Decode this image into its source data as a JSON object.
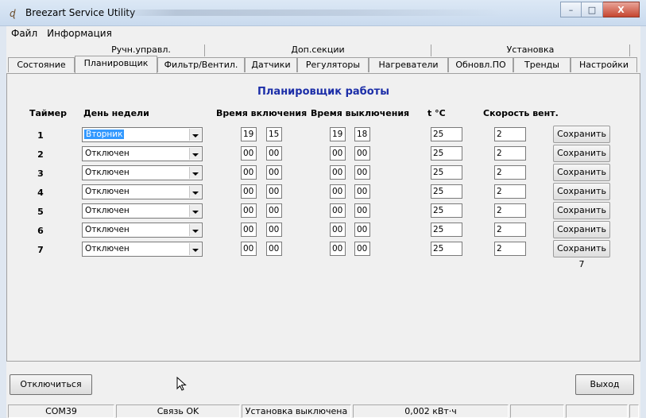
{
  "window": {
    "title": "Breezart Service Utility",
    "app_icon": "breezart-icon",
    "controls": {
      "minimize": "–",
      "maximize": "□",
      "close": "X"
    }
  },
  "menu": [
    "Файл",
    "Информация"
  ],
  "tabs": {
    "top_row": [
      "Ручн.управл.",
      "Доп.секции",
      "Установка"
    ],
    "bottom_row": [
      "Состояние",
      "Планировщик",
      "Фильтр/Вентил.",
      "Датчики",
      "Регуляторы",
      "Нагреватели",
      "Обновл.ПО",
      "Тренды",
      "Настройки"
    ],
    "active": "Планировщик"
  },
  "scheduler": {
    "title": "Планировщик работы",
    "headers": {
      "timer": "Таймер",
      "weekday": "День недели",
      "on_time": "Время включения",
      "off_time": "Время выключения",
      "temp": "t °C",
      "fan_speed": "Скорость вент."
    },
    "rows": [
      {
        "num": "1",
        "weekday": "Вторник",
        "on_h": "19",
        "on_m": "15",
        "off_h": "19",
        "off_m": "18",
        "temp": "25",
        "speed": "2",
        "save": "Сохранить 1"
      },
      {
        "num": "2",
        "weekday": "Отключен",
        "on_h": "00",
        "on_m": "00",
        "off_h": "00",
        "off_m": "00",
        "temp": "25",
        "speed": "2",
        "save": "Сохранить 2"
      },
      {
        "num": "3",
        "weekday": "Отключен",
        "on_h": "00",
        "on_m": "00",
        "off_h": "00",
        "off_m": "00",
        "temp": "25",
        "speed": "2",
        "save": "Сохранить 3"
      },
      {
        "num": "4",
        "weekday": "Отключен",
        "on_h": "00",
        "on_m": "00",
        "off_h": "00",
        "off_m": "00",
        "temp": "25",
        "speed": "2",
        "save": "Сохранить 4"
      },
      {
        "num": "5",
        "weekday": "Отключен",
        "on_h": "00",
        "on_m": "00",
        "off_h": "00",
        "off_m": "00",
        "temp": "25",
        "speed": "2",
        "save": "Сохранить 5"
      },
      {
        "num": "6",
        "weekday": "Отключен",
        "on_h": "00",
        "on_m": "00",
        "off_h": "00",
        "off_m": "00",
        "temp": "25",
        "speed": "2",
        "save": "Сохранить 6"
      },
      {
        "num": "7",
        "weekday": "Отключен",
        "on_h": "00",
        "on_m": "00",
        "off_h": "00",
        "off_m": "00",
        "temp": "25",
        "speed": "2",
        "save": "Сохранить 7"
      }
    ]
  },
  "buttons": {
    "disconnect": "Отключиться",
    "exit": "Выход"
  },
  "status": {
    "port": "COM39",
    "link": "Связь OK",
    "unit": "Установка выключена",
    "energy": "0,002 кВт·ч"
  },
  "colors": {
    "panel_title": "#1c2ea8",
    "selection": "#3399ff"
  }
}
